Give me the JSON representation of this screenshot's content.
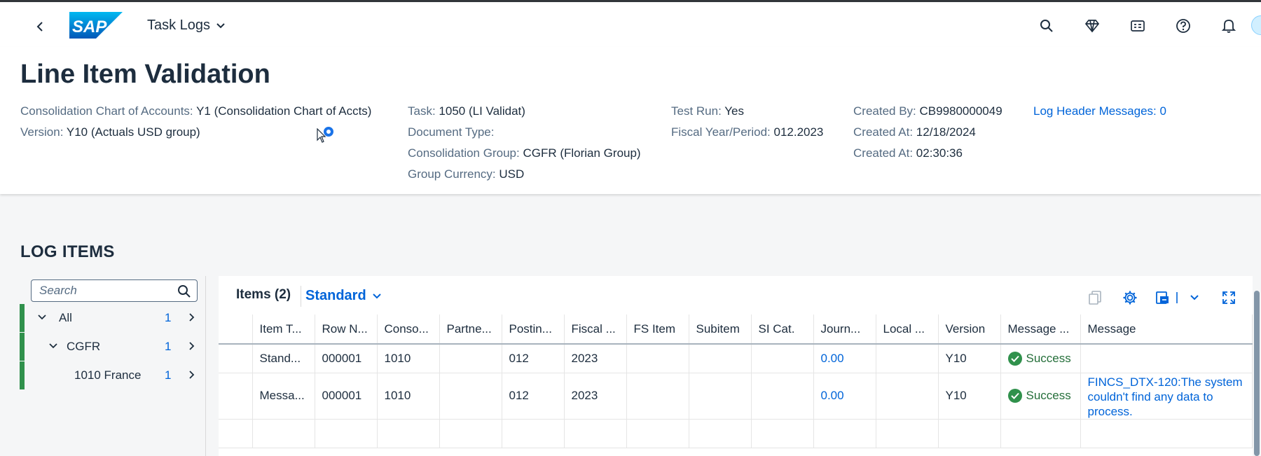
{
  "shell": {
    "app_title": "Task Logs",
    "logo_text": "SAP"
  },
  "header": {
    "title": "Line Item Validation",
    "col1": [
      {
        "label": "Consolidation Chart of Accounts:",
        "value": "Y1 (Consolidation Chart of Accts)"
      },
      {
        "label": "Version:",
        "value": "Y10 (Actuals USD group)"
      }
    ],
    "col2": [
      {
        "label": "Task:",
        "value": "1050 (LI Validat)"
      },
      {
        "label": "Document Type:",
        "value": ""
      },
      {
        "label": "Consolidation Group:",
        "value": "CGFR (Florian Group)"
      },
      {
        "label": "Group Currency:",
        "value": "USD"
      }
    ],
    "col3": [
      {
        "label": "Test Run:",
        "value": "Yes"
      },
      {
        "label": "Fiscal Year/Period:",
        "value": "012.2023"
      }
    ],
    "col4": [
      {
        "label": "Created By:",
        "value": "CB9980000049"
      },
      {
        "label": "Created At:",
        "value": "12/18/2024"
      },
      {
        "label": "Created At:",
        "value": "02:30:36"
      }
    ],
    "log_header_link": "Log Header Messages: 0"
  },
  "section_title": "LOG ITEMS",
  "tree": {
    "search_placeholder": "Search",
    "items": [
      {
        "name": "All",
        "count": "1"
      },
      {
        "name": "CGFR",
        "count": "1"
      },
      {
        "name": "1010 France",
        "count": "1"
      }
    ]
  },
  "table": {
    "title": "Items (2)",
    "variant": "Standard",
    "columns": [
      "Item T...",
      "Row N...",
      "Conso...",
      "Partne...",
      "Postin...",
      "Fiscal ...",
      "FS Item",
      "Subitem",
      "SI Cat.",
      "Journ...",
      "Local ...",
      "Version",
      "Message ...",
      "Message"
    ],
    "rows": [
      {
        "item_type": "Stand...",
        "row_no": "000001",
        "conso": "1010",
        "partner": "",
        "posting": "012",
        "fiscal": "2023",
        "fs_item": "",
        "subitem": "",
        "si_cat": "",
        "journal": "0.00",
        "local": "",
        "version": "Y10",
        "msg_type": "Success",
        "message": ""
      },
      {
        "item_type": "Messa...",
        "row_no": "000001",
        "conso": "1010",
        "partner": "",
        "posting": "012",
        "fiscal": "2023",
        "fs_item": "",
        "subitem": "",
        "si_cat": "",
        "journal": "0.00",
        "local": "",
        "version": "Y10",
        "msg_type": "Success",
        "message": "FINCS_DTX-120:The system couldn't find any data to process."
      }
    ]
  },
  "colors": {
    "accent": "#0064d9",
    "success": "#30914c",
    "text": "#1d2d3e",
    "label": "#556b82"
  }
}
